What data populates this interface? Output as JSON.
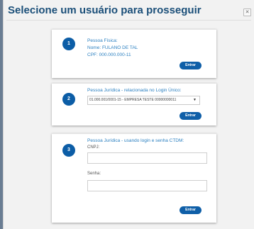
{
  "modal": {
    "title": "Selecione um usuário para prosseguir",
    "close_glyph": "✕"
  },
  "cards": [
    {
      "step": "1",
      "heading": "Pessoa Física:",
      "lines": [
        "Nome: FULANO DE TAL",
        "CPF: 000.000.000-11"
      ],
      "button_label": "Entrar"
    },
    {
      "step": "2",
      "heading": "Pessoa Jurídica - relacionada no Login Único:",
      "select_value": "01.000.001/0001-15 - EMPRESA TESTE 00000000011",
      "select_arrow": "▼",
      "button_label": "Entrar"
    },
    {
      "step": "3",
      "heading": "Pessoa Jurídica - usando login e senha CTDM:",
      "cnpj_label": "CNPJ:",
      "senha_label": "Senha:",
      "cnpj_value": "",
      "senha_value": "",
      "button_label": "Entrar"
    }
  ],
  "colors": {
    "title": "#1b4f79",
    "accent": "#0c5da6",
    "card_text": "#2a7fc0",
    "backdrop": "#5c6f86"
  }
}
